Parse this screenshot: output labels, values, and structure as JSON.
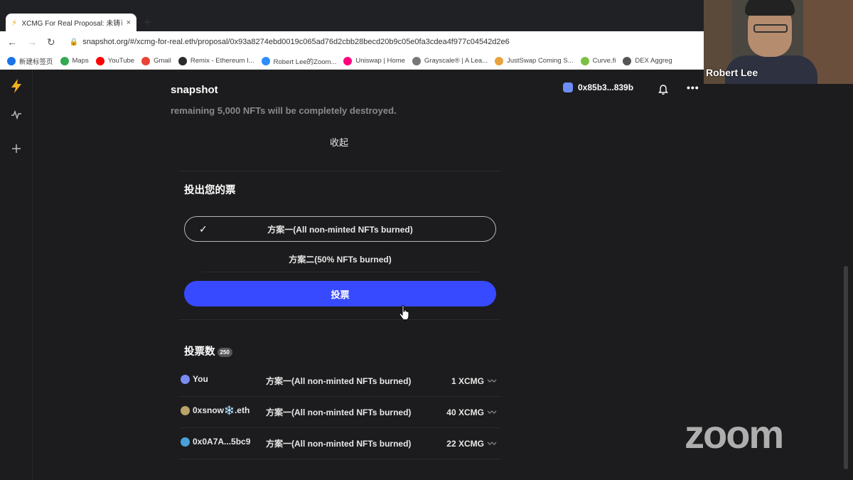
{
  "browser": {
    "tab_title": "XCMG For Real Proposal: 未铸币",
    "tab_close": "×",
    "new_tab": "+",
    "url": "snapshot.org/#/xcmg-for-real.eth/proposal/0x93a8274ebd0019c065ad76d2cbb28becd20b9c05e0fa3cdea4f977c04542d2e6",
    "bookmarks": [
      {
        "label": "新建标签页",
        "color": "#1a73e8",
        "icon": "globe-icon"
      },
      {
        "label": "Maps",
        "color": "#34a853",
        "icon": "maps-icon"
      },
      {
        "label": "YouTube",
        "color": "#ff0000",
        "icon": "youtube-icon"
      },
      {
        "label": "Gmail",
        "color": "#ea4335",
        "icon": "gmail-icon"
      },
      {
        "label": "Remix - Ethereum I...",
        "color": "#2b2b2b",
        "icon": "remix-icon"
      },
      {
        "label": "Robert Lee的Zoom...",
        "color": "#2d8cff",
        "icon": "zoom-icon"
      },
      {
        "label": "Uniswap | Home",
        "color": "#ff007a",
        "icon": "uniswap-icon"
      },
      {
        "label": "Grayscale® | A Lea...",
        "color": "#777777",
        "icon": "grayscale-icon"
      },
      {
        "label": "JustSwap Coming S...",
        "color": "#e8a33d",
        "icon": "justswap-icon"
      },
      {
        "label": "Curve.fi",
        "color": "#7bc043",
        "icon": "curve-icon"
      },
      {
        "label": "DEX Aggreg",
        "color": "#555555",
        "icon": "dex-icon"
      }
    ]
  },
  "app": {
    "brand": "snapshot",
    "wallet": "0x85b3...839b",
    "faded_text": "remaining 5,000 NFTs will be completely destroyed.",
    "collapse": "收起",
    "cast_title": "投出您的票",
    "choices": [
      {
        "label": "方案一(All non-minted NFTs burned)",
        "selected": true
      },
      {
        "label": "方案二(50% NFTs burned)",
        "selected": false
      }
    ],
    "vote_button": "投票",
    "votes_title": "投票数",
    "votes_count": "250",
    "votes": [
      {
        "voter": "You",
        "choice": "方案一(All non-minted NFTs burned)",
        "power": "1 XCMG",
        "color": "#7b8cf0"
      },
      {
        "voter": "0xsnow❄️.eth",
        "choice": "方案一(All non-minted NFTs burned)",
        "power": "40 XCMG",
        "color": "#b8a36a"
      },
      {
        "voter": "0x0A7A...5bc9",
        "choice": "方案一(All non-minted NFTs burned)",
        "power": "22 XCMG",
        "color": "#4aa0d8"
      }
    ]
  },
  "zoom": {
    "participant_name": "Robert Lee",
    "watermark": "zoom"
  }
}
